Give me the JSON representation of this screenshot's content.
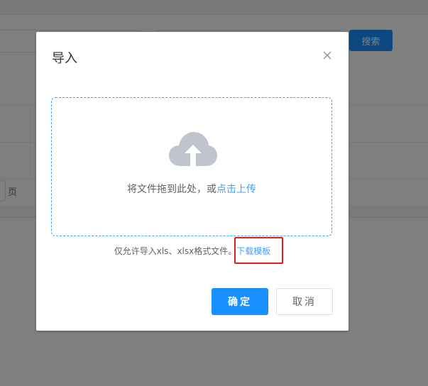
{
  "background": {
    "search_button_label": "搜索",
    "pager_suffix": "页"
  },
  "dialog": {
    "title": "导入",
    "upload": {
      "text_prefix": "将文件拖到此处，或",
      "text_link": "点击上传"
    },
    "tip": {
      "text": "仅允许导入xls、xlsx格式文件。",
      "link": "下载模板"
    },
    "buttons": {
      "confirm": "确定",
      "cancel": "取消"
    }
  },
  "colors": {
    "primary": "#1890ff",
    "link": "#409eff",
    "highlight": "#e02020",
    "overlay": "rgba(0,0,0,0.5)"
  },
  "icons": {
    "close": "close-icon",
    "upload": "cloud-upload-icon"
  }
}
